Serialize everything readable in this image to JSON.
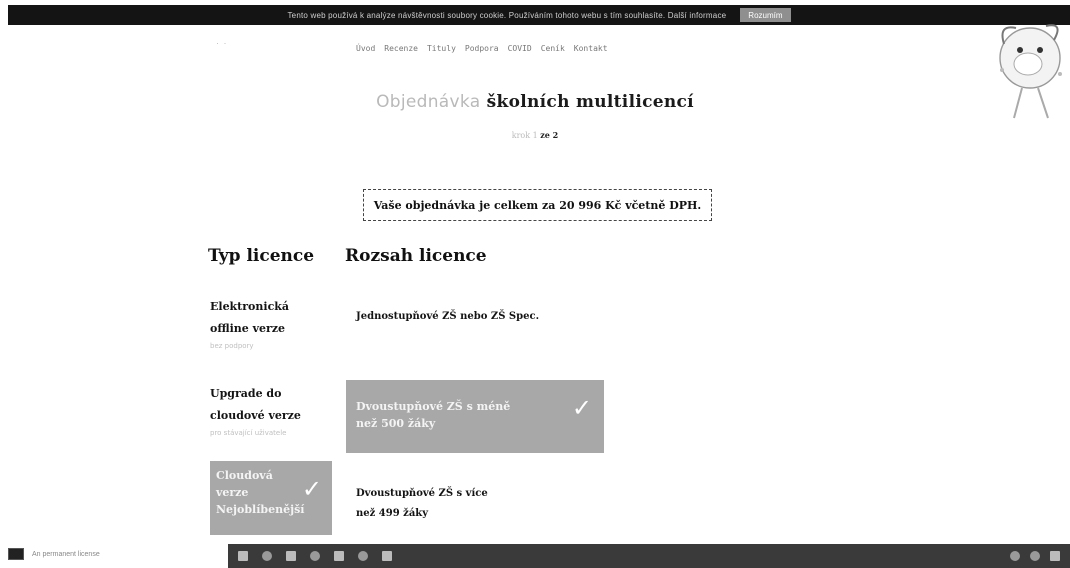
{
  "cookie_bar": {
    "text": "Tento web používá k analýze návštěvnosti soubory cookie. Používáním tohoto webu s tím souhlasíte. Další informace",
    "button_label": "Rozumím"
  },
  "site": {
    "logo_text": "· ·"
  },
  "nav": {
    "items": [
      "Úvod",
      "Recenze",
      "Tituly",
      "Podpora",
      "COVID",
      "Ceník",
      "Kontakt"
    ]
  },
  "page": {
    "title_light": "Objednávka",
    "title_bold": "školních multilicencí",
    "step_muted": "krok 1",
    "step_bold": "ze 2"
  },
  "order_total": "Vaše objednávka je celkem za 20 996 Kč včetně DPH.",
  "columns": {
    "type_heading": "Typ licence",
    "range_heading": "Rozsah licence"
  },
  "license_types": [
    {
      "line1": "Elektronická",
      "line2": "offline verze",
      "note": "bez podpory"
    },
    {
      "line1": "Upgrade do",
      "line2": "cloudové verze",
      "note": "pro stávající uživatele"
    },
    {
      "line1": "Cloudová",
      "line2": "verze",
      "line3": "Nejoblíbenější",
      "selected": true
    }
  ],
  "license_ranges": [
    {
      "line1": "Jednostupňové ZŠ nebo ZŠ Spec."
    },
    {
      "line1": "Dvoustupňové ZŠ s méně",
      "line2": "než 500 žáky",
      "selected": true
    },
    {
      "line1": "Dvoustupňové ZŠ s více",
      "line2": "než 499 žáky"
    }
  ],
  "icons": {
    "check": "check-icon"
  },
  "bottom_status": {
    "text": "An permanent license"
  },
  "colors": {
    "selected_bg": "#a8a8a8",
    "cookie_bg": "#141414",
    "taskbar_bg": "#3a3a3a"
  }
}
